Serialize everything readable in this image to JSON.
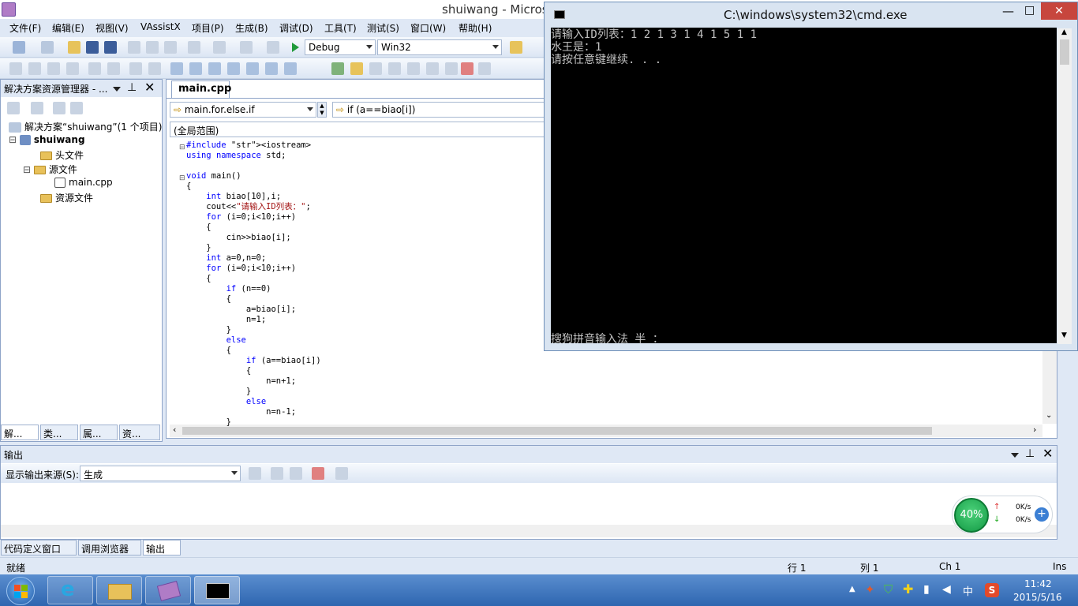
{
  "title": "shuiwang - Micros",
  "menu": [
    "文件(F)",
    "编辑(E)",
    "视图(V)",
    "VAssistX",
    "项目(P)",
    "生成(B)",
    "调试(D)",
    "工具(T)",
    "测试(S)",
    "窗口(W)",
    "帮助(H)"
  ],
  "toolbar": {
    "config": "Debug",
    "platform": "Win32"
  },
  "solution_panel": {
    "header": "解决方案资源管理器 - ...",
    "tree": [
      "解决方案“shuiwang”(1 个项目)",
      "shuiwang",
      "头文件",
      "源文件",
      "main.cpp",
      "资源文件"
    ],
    "tabs": [
      "解...",
      "类...",
      "属...",
      "资..."
    ]
  },
  "editor": {
    "tab": "main.cpp",
    "func_combo": "main.for.else.if",
    "scope_combo": "if (a==biao[i])",
    "global": "(全局范围)",
    "lines": [
      "#include <iostream>",
      "using namespace std;",
      "",
      "void main()",
      "{",
      "    int biao[10],i;",
      "    cout<<\"请输入ID列表：\";",
      "    for (i=0;i<10;i++)",
      "    {",
      "        cin>>biao[i];",
      "    }",
      "    int a=0,n=0;",
      "    for (i=0;i<10;i++)",
      "    {",
      "        if (n==0)",
      "        {",
      "            a=biao[i];",
      "            n=1;",
      "        }",
      "        else",
      "        {",
      "            if (a==biao[i])",
      "            {",
      "                n=n+1;",
      "            }",
      "            else",
      "                n=n-1;",
      "        }"
    ]
  },
  "cmd": {
    "title": "C:\\windows\\system32\\cmd.exe",
    "lines": [
      "请输入ID列表：1 2 1 3 1 4 1 5 1 1",
      "水王是：1",
      "请按任意键继续. . ."
    ],
    "ime": "搜狗拼音输入法 半 ："
  },
  "output": {
    "header": "输出",
    "source_label": "显示输出来源(S):",
    "source_value": "生成",
    "tabs": [
      "代码定义窗口",
      "调用浏览器",
      "输出"
    ]
  },
  "status": {
    "left": "就绪",
    "row": "行 1",
    "col": "列 1",
    "ch": "Ch 1",
    "ins": "Ins"
  },
  "netmon": {
    "percent": "40%",
    "up": "0K/s",
    "down": "0K/s"
  },
  "clock": {
    "time": "11:42",
    "date": "2015/5/16"
  },
  "tray_ime": "中"
}
